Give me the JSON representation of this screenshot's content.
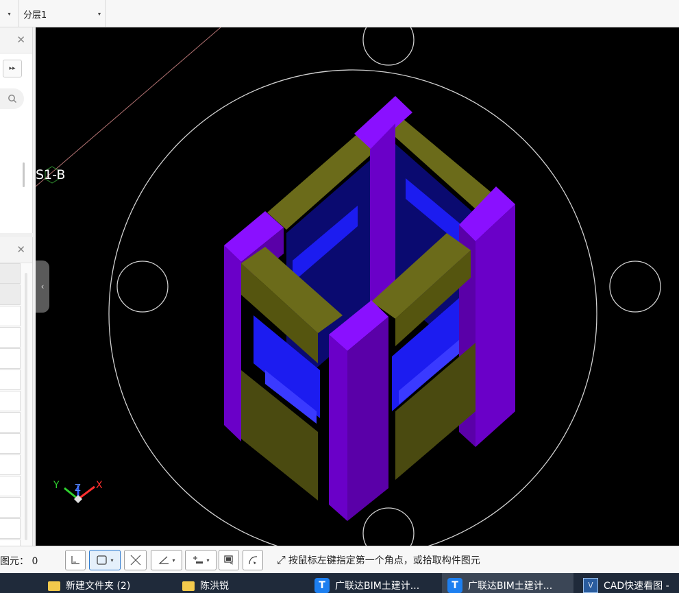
{
  "toolbar": {
    "layer_value": "分层1",
    "dropdown_arrow": "▾"
  },
  "panels": {
    "close_glyph": "✕",
    "forward_glyph": "▸▸",
    "collapse_glyph": "‹"
  },
  "viewport": {
    "axis_label": "S1-B",
    "gizmo": {
      "x": "X",
      "y": "Y",
      "z": "Z"
    }
  },
  "statusbar": {
    "selected_label": "图元：",
    "selected_count": "0",
    "hint": "按鼠标左键指定第一个角点，或拾取构件图元",
    "hint_icon": "⤢"
  },
  "taskbar": {
    "items": [
      {
        "label": "新建文件夹 (2)",
        "icon": "folder-icon"
      },
      {
        "label": "陈洪锐",
        "icon": "folder-icon"
      },
      {
        "label": "广联达BIM土建计...",
        "icon": "glodon-icon"
      },
      {
        "label": "广联达BIM土建计...",
        "icon": "glodon-icon"
      },
      {
        "label": "CAD快速看图 -",
        "icon": "cad-icon"
      }
    ],
    "glodon_glyph": "T",
    "cad_glyph": "\\/"
  },
  "colors": {
    "purple": "#7a00e6",
    "olive": "#6b6b1a",
    "blue": "#1c1cf0",
    "dark_blue": "#0a0a70",
    "taskbar": "#1f2a3a"
  }
}
